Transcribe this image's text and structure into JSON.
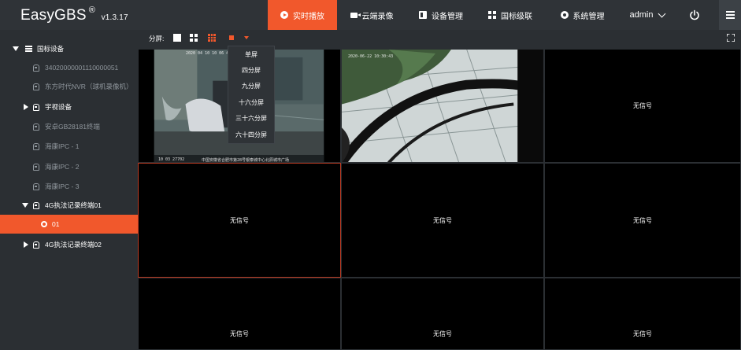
{
  "app": {
    "name": "EasyGBS",
    "reg": "®",
    "version": "v1.3.17"
  },
  "nav": [
    {
      "label": "实时播放",
      "icon": "play-circle-icon"
    },
    {
      "label": "云端录像",
      "icon": "video-camera-icon"
    },
    {
      "label": "设备管理",
      "icon": "device-icon"
    },
    {
      "label": "国标级联",
      "icon": "grid-icon"
    },
    {
      "label": "系统管理",
      "icon": "gear-icon"
    }
  ],
  "user": {
    "name": "admin"
  },
  "sidebar": {
    "root": "国标设备",
    "items": [
      {
        "label": "34020000001110000051"
      },
      {
        "label": "东方时代NVR（球机录像机）"
      },
      {
        "label": "宇视设备"
      },
      {
        "label": "安卓GB28181终端"
      },
      {
        "label": "海康IPC - 1"
      },
      {
        "label": "海康IPC - 2"
      },
      {
        "label": "海康IPC - 3"
      },
      {
        "label": "4G执法记录终端01"
      },
      {
        "label": "01"
      },
      {
        "label": "4G执法记录终端02"
      }
    ]
  },
  "toolbar": {
    "split_label": "分屏:"
  },
  "split_menu": {
    "options": [
      "单屏",
      "四分屏",
      "九分屏",
      "十六分屏",
      "三十六分屏",
      "六十四分屏"
    ]
  },
  "video": {
    "no_signal": "无信号",
    "cam1_ts_top": "2020 04 10 10 06 45",
    "cam1_ts_bottom": "10 03 27702",
    "cam1_caption": "中国安徽省合肥市第28号银泰城中心北辰城市广场",
    "cam2_ts": "2020-06-22 10:30:43"
  },
  "colors": {
    "accent": "#f1582c",
    "topbar": "#2f3337",
    "sidebar": "#2b2f33",
    "selected_border": "#b83a22"
  }
}
